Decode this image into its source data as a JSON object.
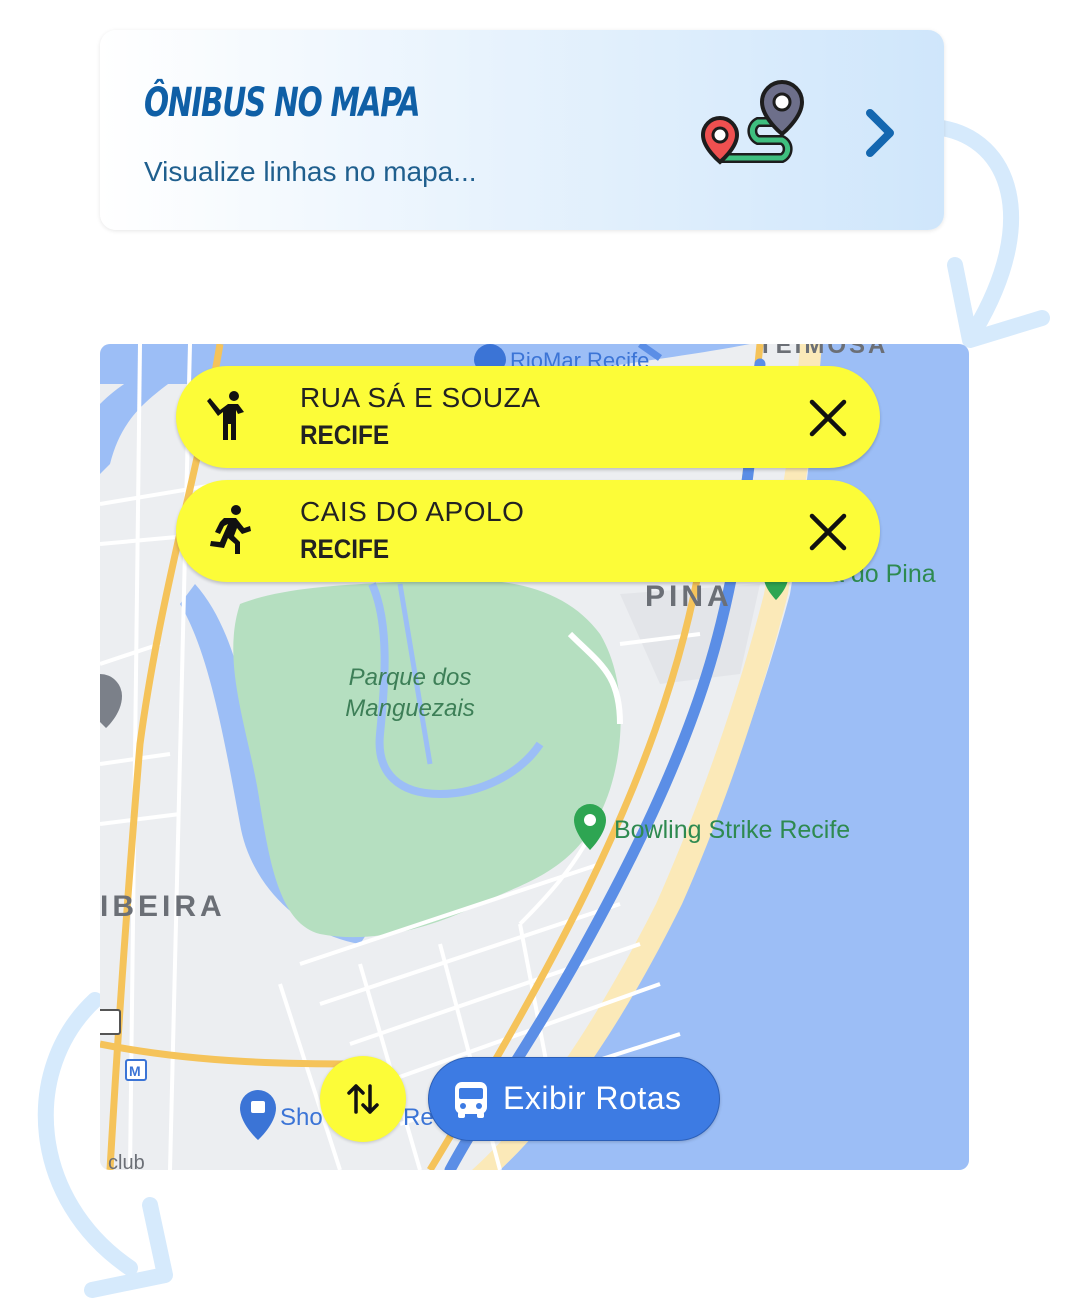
{
  "promo": {
    "title": "ÔNIBUS NO MAPA",
    "subtitle": "Visualize linhas no mapa...",
    "icon": "route-map-pins-icon",
    "action_icon": "chevron-right-icon"
  },
  "map": {
    "labels": {
      "teimosa": "TEIMOSA",
      "riomar": "RioMar Recife",
      "pina": "PINA",
      "do_pina": "a do Pina",
      "park": "Parque dos Manguezais",
      "bowling": "Bowling Strike Recife",
      "ribeira": "IBEIRA",
      "sho": "Sho",
      "re": "Re",
      "club": "club"
    }
  },
  "origin": {
    "icon": "person-hailing-icon",
    "street": "RUA SÁ E SOUZA",
    "city": "RECIFE",
    "close_icon": "close-icon"
  },
  "destination": {
    "icon": "person-running-icon",
    "street": "CAIS DO APOLO",
    "city": "RECIFE",
    "close_icon": "close-icon"
  },
  "controls": {
    "swap_icon": "swap-vertical-icon",
    "routes_icon": "bus-icon",
    "routes_label": "Exibir Rotas"
  },
  "colors": {
    "accent_yellow": "#fcfc38",
    "button_blue": "#3d7be3",
    "title_blue": "#0f5fa6",
    "sea": "#9bbef7",
    "park": "#b5dfc0"
  }
}
